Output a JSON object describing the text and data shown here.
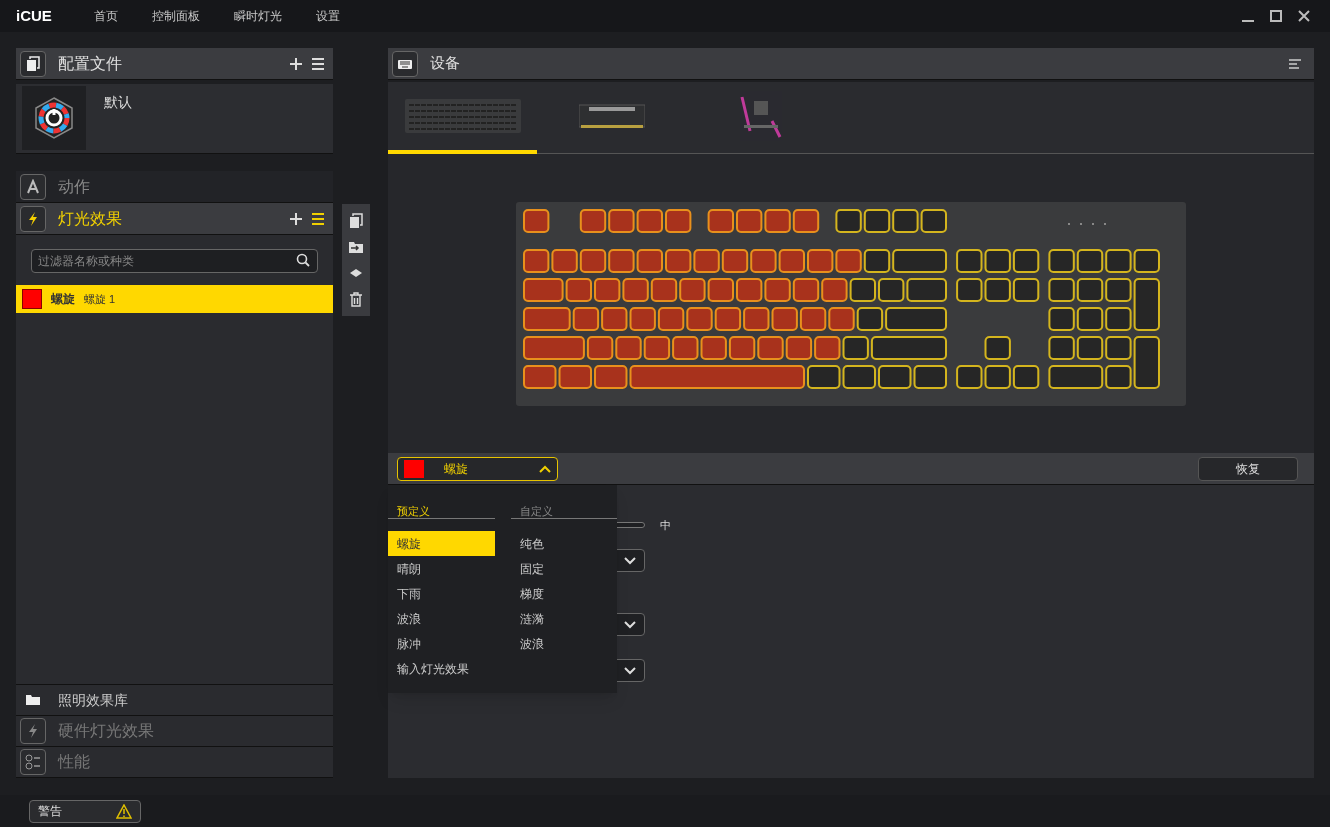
{
  "app": {
    "logo": "iCUE",
    "nav": [
      {
        "label": "首页"
      },
      {
        "label": "控制面板"
      },
      {
        "label": "瞬时灯光"
      },
      {
        "label": "设置"
      }
    ]
  },
  "profiles": {
    "title": "配置文件",
    "items": [
      {
        "name": "默认"
      }
    ]
  },
  "actions": {
    "title": "动作"
  },
  "lighting": {
    "title": "灯光效果",
    "filter": {
      "placeholder": "过滤器名称或种类"
    },
    "effects": [
      {
        "color": "#ff0000",
        "name": "螺旋",
        "layer": "螺旋 1",
        "selected": true
      }
    ]
  },
  "bottom_sections": [
    {
      "kind": "library",
      "title": "照明效果库"
    },
    {
      "kind": "hardware",
      "title": "硬件灯光效果"
    },
    {
      "kind": "performance",
      "title": "性能"
    }
  ],
  "devices": {
    "title": "设备",
    "tabs": [
      {
        "kind": "keyboard",
        "selected": true
      },
      {
        "kind": "memory",
        "selected": false
      },
      {
        "kind": "motherboard",
        "selected": false
      }
    ]
  },
  "effect_picker": {
    "value": "螺旋",
    "color": "#ff0000",
    "expanded": true,
    "reset_button": "恢复",
    "groups": [
      {
        "title": "预定义",
        "selected": true,
        "items": [
          {
            "label": "螺旋",
            "selected": true
          },
          {
            "label": "晴朗",
            "selected": false
          },
          {
            "label": "下雨",
            "selected": false
          },
          {
            "label": "波浪",
            "selected": false
          },
          {
            "label": "脉冲",
            "selected": false
          },
          {
            "label": "输入灯光效果",
            "selected": false
          }
        ]
      },
      {
        "title": "自定义",
        "selected": false,
        "items": [
          {
            "label": "纯色",
            "selected": false
          },
          {
            "label": "固定",
            "selected": false
          },
          {
            "label": "梯度",
            "selected": false
          },
          {
            "label": "涟漪",
            "selected": false
          },
          {
            "label": "波浪",
            "selected": false
          }
        ]
      }
    ]
  },
  "speed_reading": "中",
  "status_bar": {
    "warning": "警告"
  }
}
